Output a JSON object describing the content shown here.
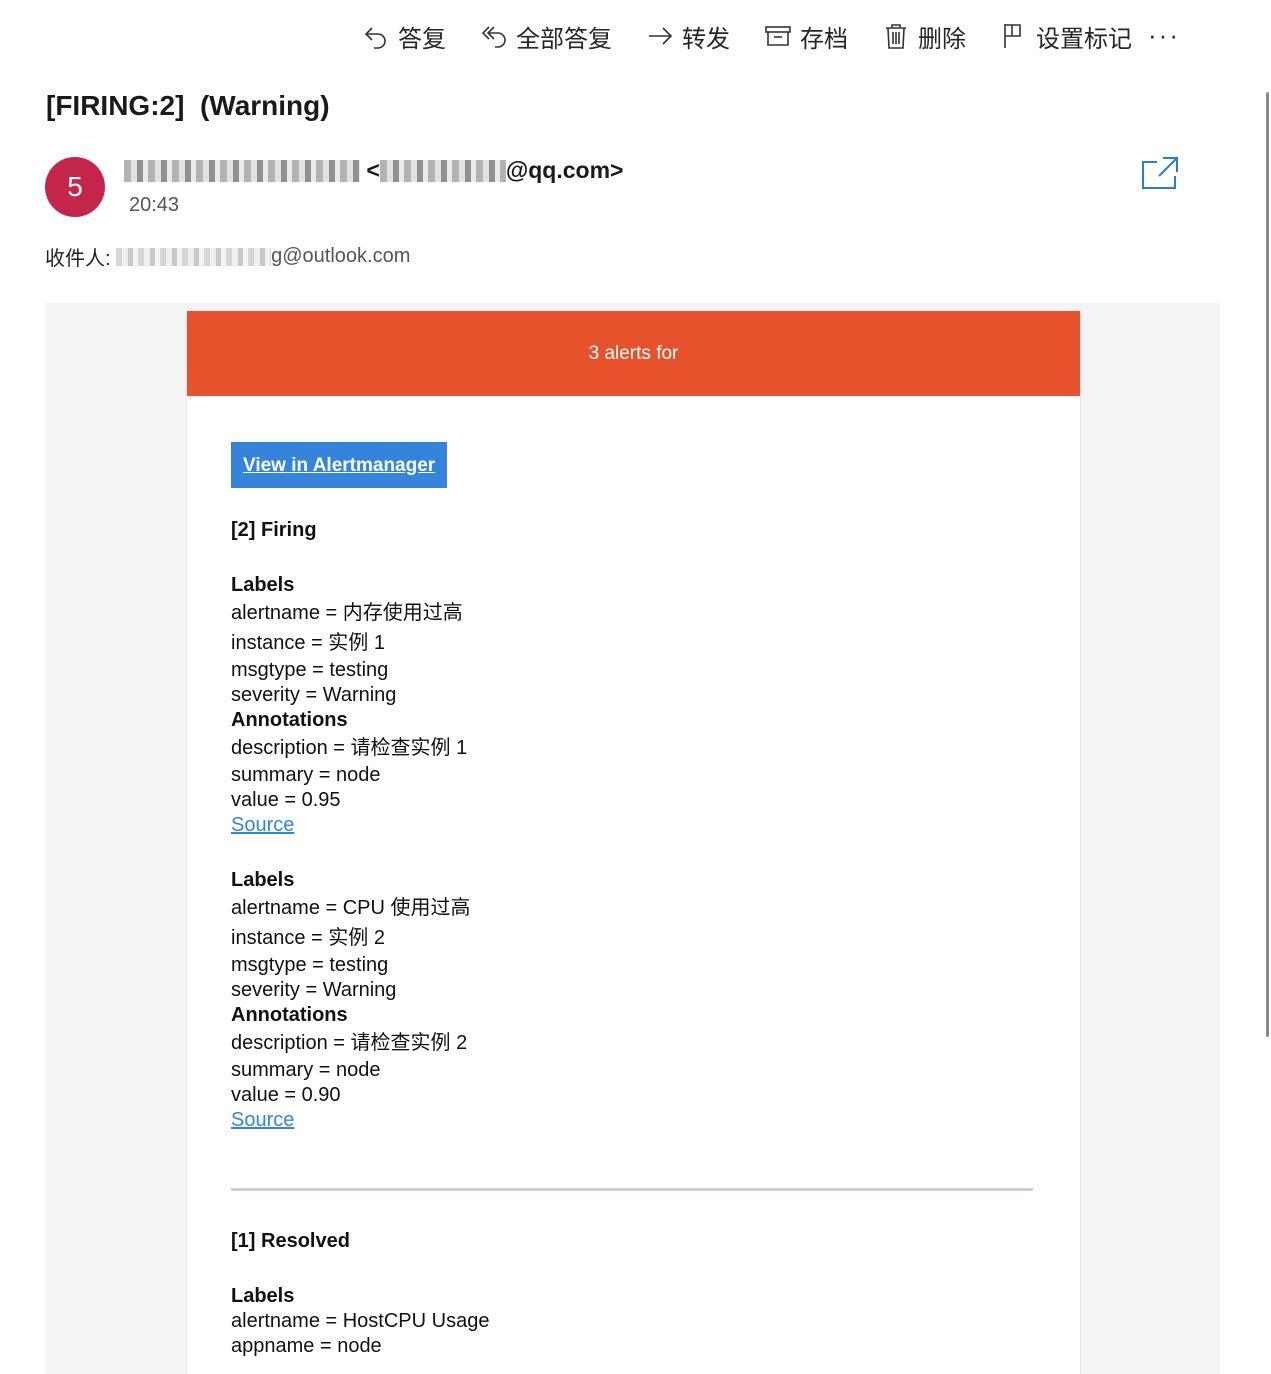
{
  "toolbar": {
    "reply": "答复",
    "reply_all": "全部答复",
    "forward": "转发",
    "archive": "存档",
    "delete": "删除",
    "flag": "设置标记",
    "more": "···"
  },
  "message": {
    "subject": "[FIRING:2]  (Warning)",
    "avatar_initial": "5",
    "avatar_color": "#c4254a",
    "sender_email_suffix": "@qq.com>",
    "sender_email_prefix": " <",
    "time": "20:43",
    "recipient_label": "收件人: ",
    "recipient_suffix": "g@outlook.com"
  },
  "email": {
    "banner": "3 alerts for",
    "banner_color": "#e5522c",
    "button": "View in Alertmanager",
    "firing_title": "[2] Firing",
    "resolved_title": "[1] Resolved",
    "firing_alerts": [
      {
        "labels_title": "Labels",
        "alertname": "alertname = 内存使用过高",
        "instance": "instance = 实例 1",
        "msgtype": "msgtype = testing",
        "severity": "severity = Warning",
        "annotations_title": "Annotations",
        "description": "description = 请检查实例 1",
        "summary": "summary = node",
        "value": "value = 0.95",
        "source": "Source"
      },
      {
        "labels_title": "Labels",
        "alertname": "alertname = CPU 使用过高",
        "instance": "instance = 实例 2",
        "msgtype": "msgtype = testing",
        "severity": "severity = Warning",
        "annotations_title": "Annotations",
        "description": "description = 请检查实例 2",
        "summary": "summary = node",
        "value": "value = 0.90",
        "source": "Source"
      }
    ],
    "resolved_alerts": [
      {
        "labels_title": "Labels",
        "alertname": "alertname = HostCPU Usage",
        "appname": "appname = node"
      }
    ]
  }
}
